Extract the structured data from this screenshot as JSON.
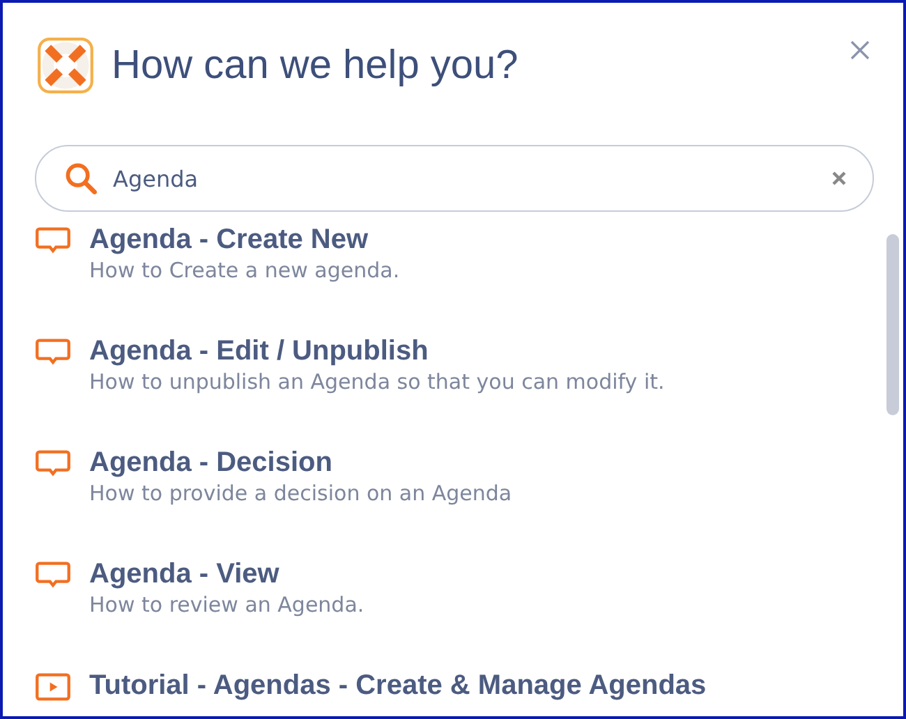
{
  "header": {
    "title": "How can we help you?"
  },
  "search": {
    "value": "Agenda"
  },
  "results": [
    {
      "kind": "article",
      "title": "Agenda - Create New",
      "description": "How to Create a new agenda."
    },
    {
      "kind": "article",
      "title": "Agenda - Edit / Unpublish",
      "description": "How to unpublish an Agenda so that you can modify it."
    },
    {
      "kind": "article",
      "title": "Agenda - Decision",
      "description": "How to provide a decision on an Agenda"
    },
    {
      "kind": "article",
      "title": "Agenda - View",
      "description": "How to review an Agenda."
    },
    {
      "kind": "video",
      "title": "Tutorial - Agendas - Create & Manage Agendas"
    }
  ]
}
